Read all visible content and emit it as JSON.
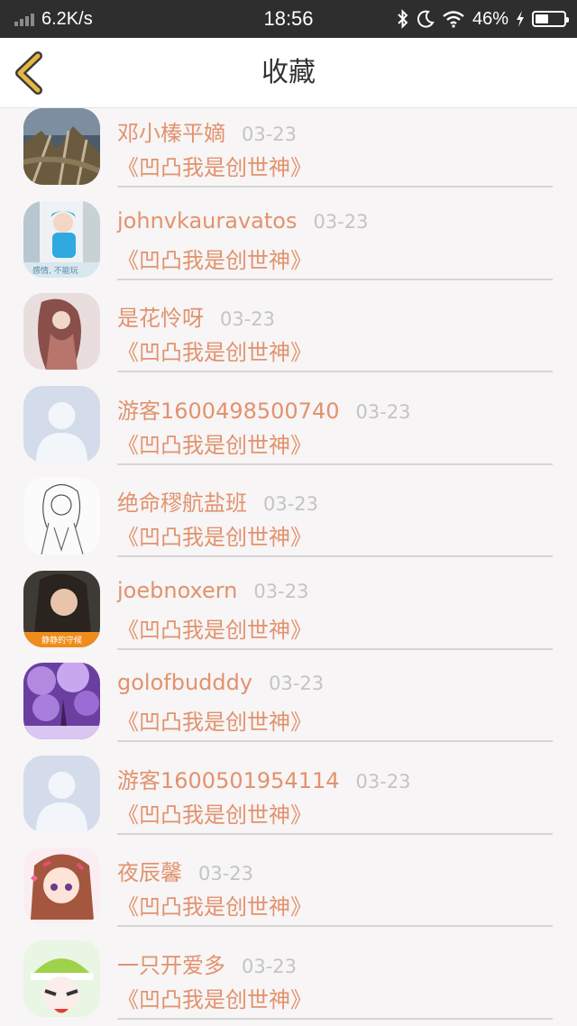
{
  "status_bar": {
    "network_speed": "6.2K/s",
    "time": "18:56",
    "battery_percent": "46%",
    "battery_level": 0.46,
    "icons": [
      "signal-icon",
      "bluetooth-icon",
      "moon-icon",
      "wifi-icon",
      "charging-icon",
      "battery-icon"
    ]
  },
  "nav": {
    "back_icon": "chevron-left-icon",
    "title": "收藏",
    "accent_color": "#e6b840"
  },
  "colors": {
    "username": "#e2926e",
    "date": "#c4c4c4",
    "divider": "#d7d4d4"
  },
  "favorites": [
    {
      "username": "邓小榛平嫡",
      "date": "03-23",
      "book": "《凹凸我是创世神》",
      "avatar": "forest-photo"
    },
    {
      "username": "johnvkauravatos",
      "date": "03-23",
      "book": "《凹凸我是创世神》",
      "avatar": "girl-blue-cap-photo"
    },
    {
      "username": "是花怜呀",
      "date": "03-23",
      "book": "《凹凸我是创世神》",
      "avatar": "anime-illustration"
    },
    {
      "username": "游客1600498500740",
      "date": "03-23",
      "book": "《凹凸我是创世神》",
      "avatar": "default-avatar"
    },
    {
      "username": "绝命穋航盐班",
      "date": "03-23",
      "book": "《凹凸我是创世神》",
      "avatar": "sketch-girl"
    },
    {
      "username": "joebnoxern",
      "date": "03-23",
      "book": "《凹凸我是创世神》",
      "avatar": "girl-photo"
    },
    {
      "username": "golofbudddy",
      "date": "03-23",
      "book": "《凹凸我是创世神》",
      "avatar": "purple-blossom-photo"
    },
    {
      "username": "游客1600501954114",
      "date": "03-23",
      "book": "《凹凸我是创世神》",
      "avatar": "default-avatar"
    },
    {
      "username": "夜辰馨",
      "date": "03-23",
      "book": "《凹凸我是创世神》",
      "avatar": "anime-girl-pink"
    },
    {
      "username": "一只开爱多",
      "date": "03-23",
      "book": "《凹凸我是创世神》",
      "avatar": "anime-character-green-hat"
    }
  ]
}
